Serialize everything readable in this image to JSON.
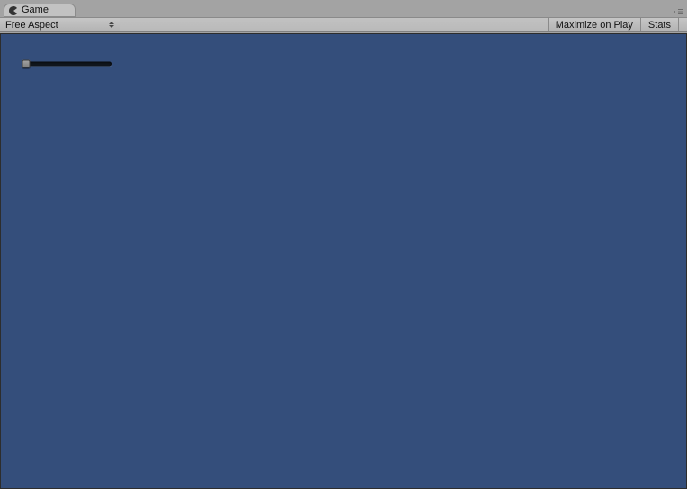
{
  "tab": {
    "label": "Game"
  },
  "toolbar": {
    "aspect_dropdown": "Free Aspect",
    "maximize_label": "Maximize on Play",
    "stats_label": "Stats"
  },
  "viewport": {
    "background": "#344e7b",
    "slider": {
      "value": 0,
      "min": 0,
      "max": 100
    }
  }
}
